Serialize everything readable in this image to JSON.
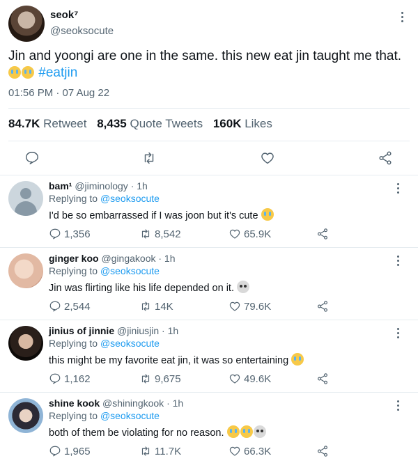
{
  "main_tweet": {
    "name": "seok⁷",
    "handle": "@seoksocute",
    "text": "Jin and yoongi are one in the same. this new eat jin taught me that.",
    "hashtag": "#eatjin",
    "timestamp": "01:56 PM · 07 Aug 22",
    "stats": {
      "retweets": "84.7K",
      "retweets_label": "Retweet",
      "quotes": "8,435",
      "quotes_label": "Quote Tweets",
      "likes": "160K",
      "likes_label": "Likes"
    }
  },
  "replies": [
    {
      "name": "bam¹",
      "handle": "@jiminology · 1h",
      "replying_label": "Replying to",
      "replying_to": "@seoksocute",
      "text": "I'd be so embarrassed if I was joon but it's cute",
      "replies": "1,356",
      "retweets": "8,542",
      "likes": "65.9K"
    },
    {
      "name": "ginger koo",
      "handle": "@gingakook · 1h",
      "replying_label": "Replying to",
      "replying_to": "@seoksocute",
      "text": "Jin was flirting like his life depended on it.",
      "replies": "2,544",
      "retweets": "14K",
      "likes": "79.6K"
    },
    {
      "name": "jinius of jinnie",
      "handle": "@jiniusjin · 1h",
      "replying_label": "Replying to",
      "replying_to": "@seoksocute",
      "text": "this might be my favorite eat jin, it was so entertaining",
      "replies": "1,162",
      "retweets": "9,675",
      "likes": "49.6K"
    },
    {
      "name": "shine kook",
      "handle": "@shiningkook · 1h",
      "replying_label": "Replying to",
      "replying_to": "@seoksocute",
      "text": "both of them be violating for no reason.",
      "replies": "1,965",
      "retweets": "11.7K",
      "likes": "66.3K"
    }
  ],
  "colors": {
    "accent": "#1d9bf0",
    "muted": "#536471",
    "text": "#0f1419",
    "divider": "#e6ecf0"
  },
  "icons": [
    "more-icon",
    "reply-icon",
    "retweet-icon",
    "like-icon",
    "share-icon",
    "crying-emoji",
    "skull-emoji"
  ]
}
